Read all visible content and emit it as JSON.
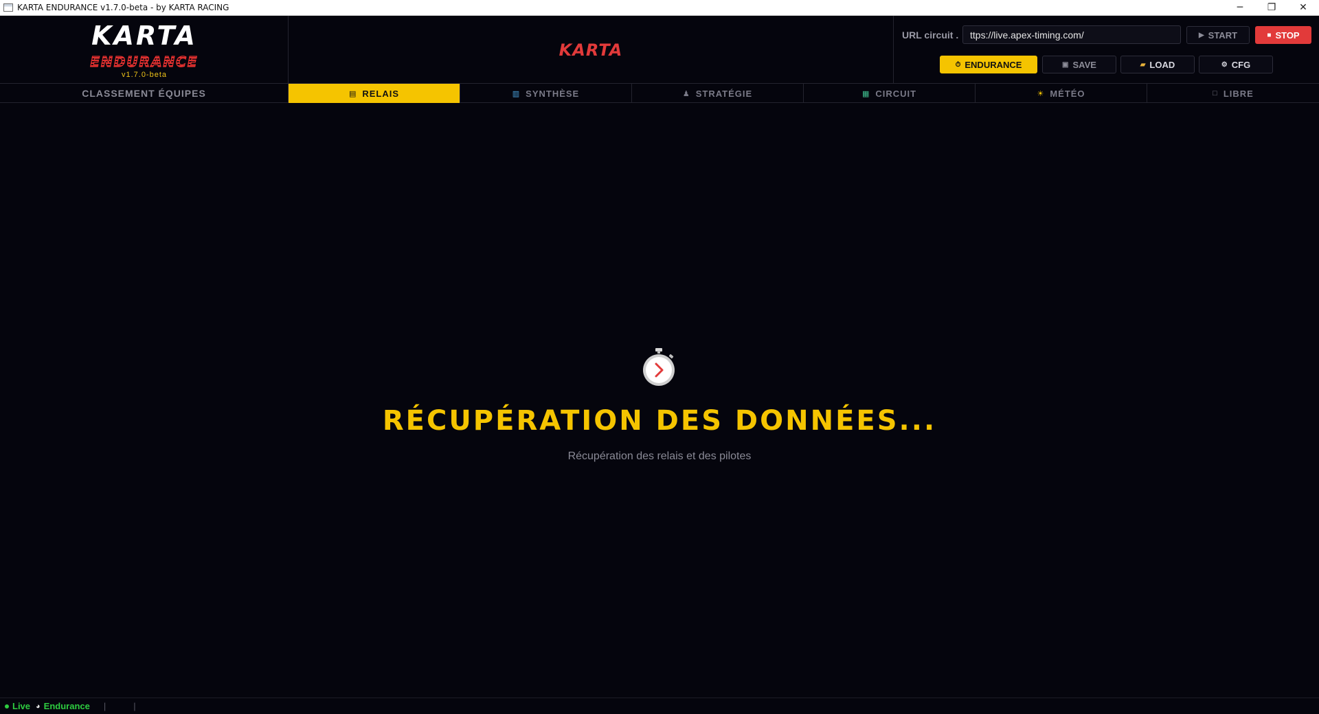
{
  "window": {
    "title": "KARTA ENDURANCE v1.7.0-beta - by KARTA RACING",
    "controls": {
      "minimize": "─",
      "restore": "❐",
      "close": "✕"
    }
  },
  "header": {
    "logo_karta": "KARTA",
    "logo_endurance": "ENDURANCE",
    "version": "v1.7.0-beta",
    "center_brand": "KARTA",
    "url_label": "URL circuit .",
    "url_value": "ttps://live.apex-timing.com/",
    "buttons": {
      "start": "START",
      "stop": "STOP",
      "endurance": "ENDURANCE",
      "save": "SAVE",
      "load": "LOAD",
      "cfg": "CFG"
    },
    "button_icons": {
      "start": "play-icon",
      "stop": "stop-square-icon",
      "endurance": "stopwatch-icon",
      "save": "floppy-disk-icon",
      "load": "folder-icon",
      "cfg": "gear-icon"
    }
  },
  "tabs": [
    {
      "label": "CLASSEMENT ÉQUIPES",
      "icon": ""
    },
    {
      "label": "RELAIS",
      "icon": "relay-icon",
      "active": true
    },
    {
      "label": "SYNTHÈSE",
      "icon": "bar-chart-icon"
    },
    {
      "label": "STRATÉGIE",
      "icon": "chess-pawn-icon"
    },
    {
      "label": "CIRCUIT",
      "icon": "map-icon"
    },
    {
      "label": "MÉTÉO",
      "icon": "sun-cloud-icon"
    },
    {
      "label": "LIBRE",
      "icon": "square-icon"
    }
  ],
  "main": {
    "icon": "stopwatch-icon",
    "title": "RÉCUPÉRATION DES DONNÉES...",
    "subtitle": "Récupération des relais et des pilotes"
  },
  "status": {
    "live": "Live",
    "mode": "Endurance",
    "separator": "|"
  },
  "colors": {
    "background": "#05050d",
    "accent_yellow": "#f5c400",
    "stop_red": "#e23a3a",
    "live_green": "#2ecc40",
    "muted_text": "#8a8a96"
  }
}
